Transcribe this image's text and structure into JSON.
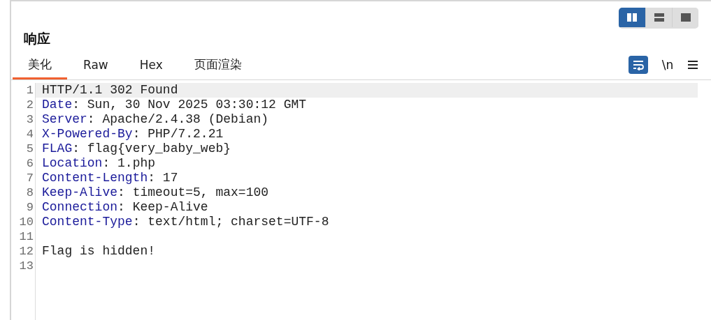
{
  "layout_toggles": [
    {
      "kind": "columns",
      "selected": true
    },
    {
      "kind": "rows",
      "selected": false
    },
    {
      "kind": "single",
      "selected": false
    }
  ],
  "panel": {
    "title": "响应"
  },
  "tabs": [
    {
      "label": "美化",
      "selected": true
    },
    {
      "label": "Raw",
      "selected": false
    },
    {
      "label": "Hex",
      "selected": false
    },
    {
      "label": "页面渲染",
      "selected": false
    }
  ],
  "toolbar": {
    "wrap": {
      "on": true
    },
    "newline_label": "\\n"
  },
  "lines": [
    {
      "number": "1",
      "kind": "text",
      "text": "HTTP/1.1 302 Found",
      "selected": true
    },
    {
      "number": "2",
      "kind": "header",
      "name": "Date",
      "value": ": Sun, 30 Nov 2025 03:30:12 GMT",
      "selected": false
    },
    {
      "number": "3",
      "kind": "header",
      "name": "Server",
      "value": ": Apache/2.4.38 (Debian)",
      "selected": false
    },
    {
      "number": "4",
      "kind": "header",
      "name": "X-Powered-By",
      "value": ": PHP/7.2.21",
      "selected": false
    },
    {
      "number": "5",
      "kind": "header",
      "name": "FLAG",
      "value": ": flag{very_baby_web}",
      "selected": false
    },
    {
      "number": "6",
      "kind": "header",
      "name": "Location",
      "value": ": 1.php",
      "selected": false
    },
    {
      "number": "7",
      "kind": "header",
      "name": "Content-Length",
      "value": ": 17",
      "selected": false
    },
    {
      "number": "8",
      "kind": "header",
      "name": "Keep-Alive",
      "value": ": timeout=5, max=100",
      "selected": false
    },
    {
      "number": "9",
      "kind": "header",
      "name": "Connection",
      "value": ": Keep-Alive",
      "selected": false
    },
    {
      "number": "10",
      "kind": "header",
      "name": "Content-Type",
      "value": ": text/html; charset=UTF-8",
      "selected": false
    },
    {
      "number": "11",
      "kind": "blank",
      "selected": false
    },
    {
      "number": "12",
      "kind": "text",
      "text": "Flag is hidden!",
      "selected": false
    },
    {
      "number": "13",
      "kind": "blank",
      "selected": false
    }
  ]
}
